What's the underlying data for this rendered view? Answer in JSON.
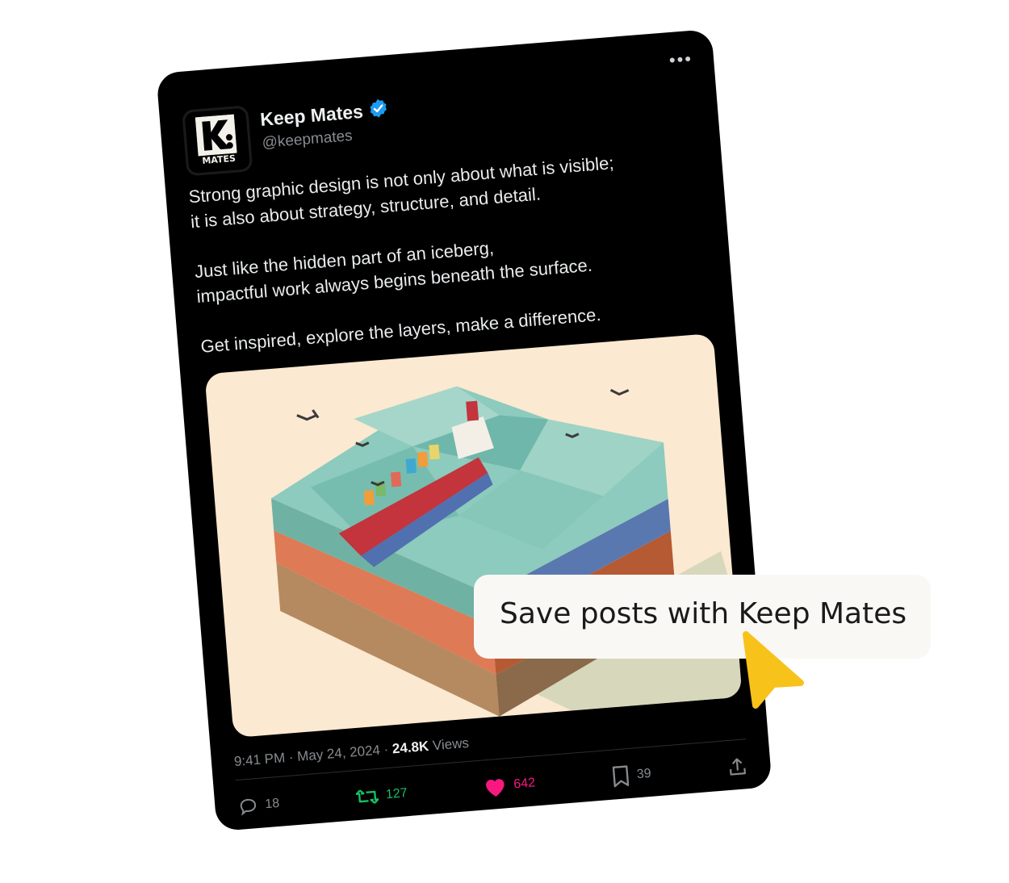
{
  "post": {
    "author_name": "Keep Mates",
    "handle": "@keepmates",
    "avatar_text": "MATES",
    "more_label": "•••",
    "paragraphs": [
      [
        "Strong graphic design is not only about what is visible;",
        "it is also about strategy, structure, and detail."
      ],
      [
        "Just like the hidden part of an iceberg,",
        "impactful work always begins beneath the surface."
      ],
      [
        "Get inspired, explore the layers, make a difference."
      ]
    ],
    "time": "9:41 PM",
    "separator": "·",
    "date": "May 24, 2024",
    "views_count": "24.8K",
    "views_label": "Views",
    "actions": {
      "replies": "18",
      "reposts": "127",
      "likes": "642",
      "bookmarks": "39"
    }
  },
  "callout": {
    "text": "Save posts with Keep Mates"
  },
  "colors": {
    "card_bg": "#000000",
    "verified": "#1d9bf0",
    "repost_green": "#17bf63",
    "like_pink": "#f91880",
    "cursor_yellow": "#f7c21a",
    "media_bg": "#fbe9d1"
  },
  "icons": [
    "verified-badge-icon",
    "more-icon",
    "reply-icon",
    "repost-icon",
    "heart-icon",
    "bookmark-icon",
    "share-icon",
    "cursor-icon"
  ]
}
